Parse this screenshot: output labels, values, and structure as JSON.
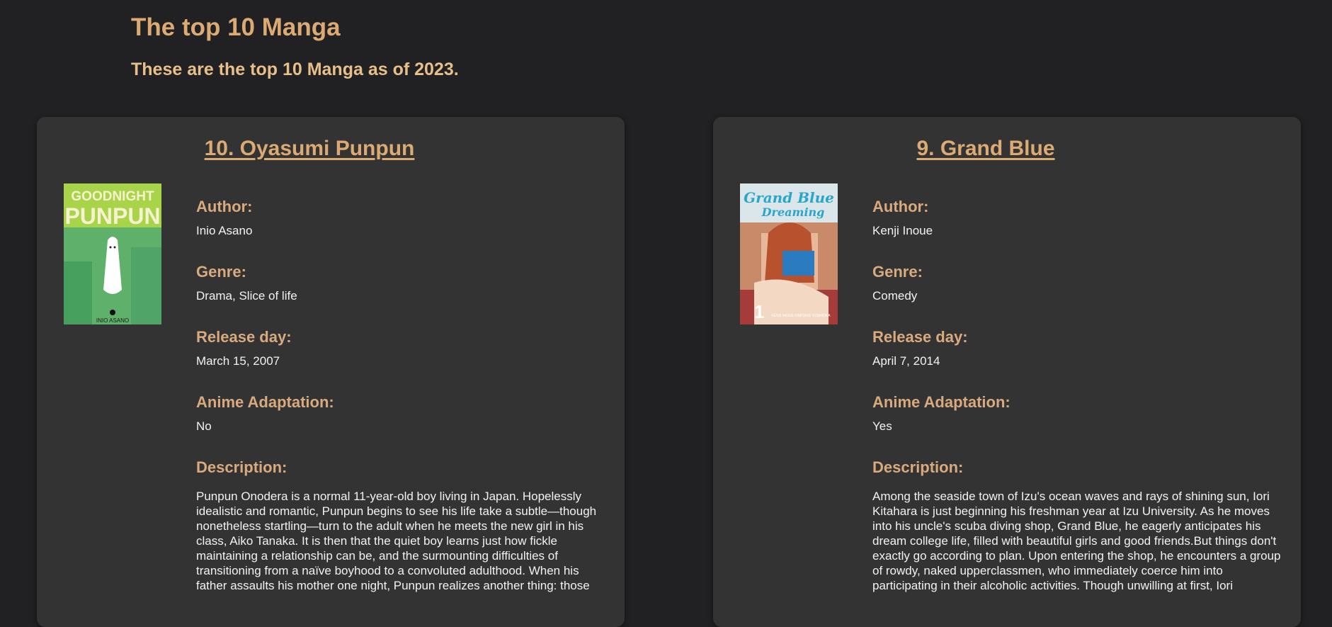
{
  "header": {
    "title": "The top 10 Manga",
    "subtitle": "These are the top 10 Manga as of 2023."
  },
  "labels": {
    "author": "Author:",
    "genre": "Genre:",
    "release": "Release day:",
    "anime": "Anime Adaptation:",
    "description": "Description:"
  },
  "manga": [
    {
      "title": "10. Oyasumi Punpun",
      "cover_text_top": "GOODNIGHT",
      "cover_text_main": "PUNPUN",
      "cover_author": "INIO ASANO",
      "author": "Inio Asano",
      "genre": "Drama, Slice of life",
      "release": "March 15, 2007",
      "anime": "No",
      "description": "Punpun Onodera is a normal 11-year-old boy living in Japan. Hopelessly idealistic and romantic, Punpun begins to see his life take a subtle—though nonetheless startling—turn to the adult when he meets the new girl in his class, Aiko Tanaka. It is then that the quiet boy learns just how fickle maintaining a relationship can be, and the surmounting difficulties of transitioning from a naïve boyhood to a convoluted adulthood. When his father assaults his mother one night, Punpun realizes another thing: those"
    },
    {
      "title": "9. Grand Blue",
      "cover_text_top": "Grand Blue",
      "cover_text_main": "Dreaming",
      "cover_author": "KENJI INOUE  KIMITAKE YOSHIOKA",
      "author": "Kenji Inoue",
      "genre": "Comedy",
      "release": "April 7, 2014",
      "anime": "Yes",
      "description": "Among the seaside town of Izu's ocean waves and rays of shining sun, Iori Kitahara is just beginning his freshman year at Izu University. As he moves into his uncle's scuba diving shop, Grand Blue, he eagerly anticipates his dream college life, filled with beautiful girls and good friends.But things don't exactly go according to plan. Upon entering the shop, he encounters a group of rowdy, naked upperclassmen, who immediately coerce him into participating in their alcoholic activities. Though unwilling at first, Iori"
    }
  ]
}
